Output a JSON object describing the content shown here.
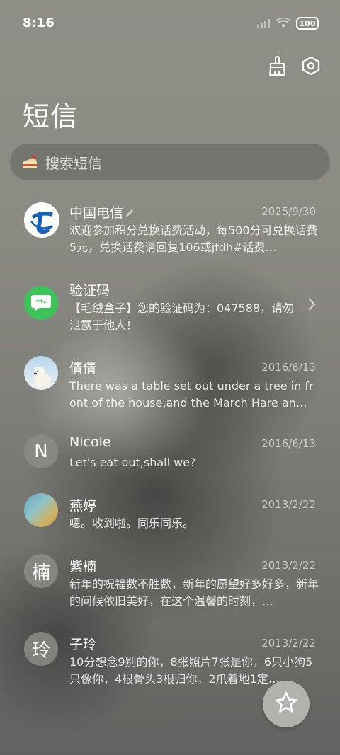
{
  "status_bar": {
    "time": "8:16",
    "battery": "100"
  },
  "header": {
    "title": "短信",
    "icons": [
      "broom-icon",
      "settings-hexagon-icon"
    ]
  },
  "search": {
    "placeholder": "搜索短信",
    "icon": "cake-icon"
  },
  "conversations": [
    {
      "name": "中国电信",
      "date": "2025/9/30",
      "preview": "欢迎参加积分兑换话费活动，每500分可兑换话费5元，兑换话费请回复106或jfdh#话费…",
      "avatar": "china-telecom-logo"
    },
    {
      "name": "验证码",
      "date": "",
      "preview": "【毛绒盒子】您的验证码为：047588，请勿泄露于他人！",
      "avatar": "message-bubble-icon"
    },
    {
      "name": "倩倩",
      "date": "2016/6/13",
      "preview": "There was a table set out under a tree in front of the house,and the March Hare an…",
      "avatar": "polar-bear-photo"
    },
    {
      "name": "Nicole",
      "date": "2016/6/13",
      "preview": "Let's eat out,shall we?",
      "avatar_letter": "N"
    },
    {
      "name": "燕婷",
      "date": "2013/2/22",
      "preview": "嗯。收到啦。同乐同乐。",
      "avatar": "landscape-photo"
    },
    {
      "name": "紫楠",
      "date": "2013/2/22",
      "preview": "新年的祝福数不胜数，新年的愿望好多好多，新年的问候依旧美好，在这个温馨的时刻，…",
      "avatar_letter": "楠"
    },
    {
      "name": "子玲",
      "date": "2013/2/22",
      "preview": "10分想念9别的你，8张照片7张是你，6只小狗5只像你，4根骨头3根归你，2爪着地1定…",
      "avatar_letter": "玲"
    }
  ],
  "fab": {
    "icon": "star-icon"
  },
  "colors": {
    "telecom_blue": "#1560b8",
    "verification_green": "#3cc45a"
  }
}
